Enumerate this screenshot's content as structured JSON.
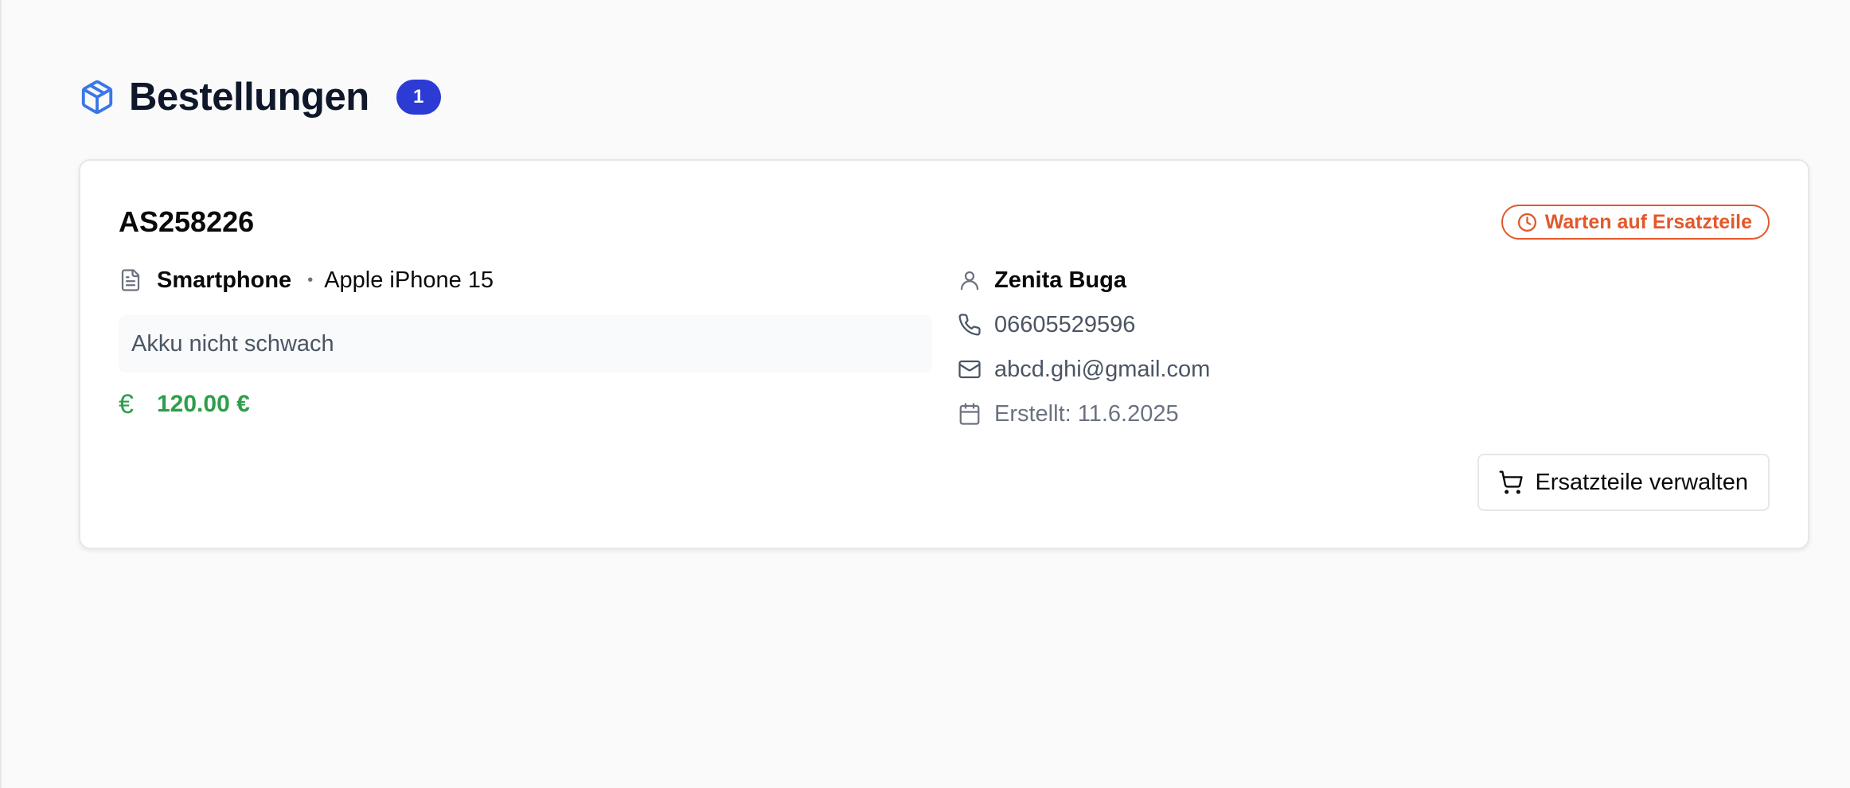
{
  "header": {
    "title": "Bestellungen",
    "count": "1",
    "icon": "package-icon",
    "icon_color": "#3b76e8",
    "badge_color": "#2b3bd3"
  },
  "order": {
    "id": "AS258226",
    "status": {
      "label": "Warten auf Ersatzteile",
      "icon": "clock-icon",
      "color": "#e2582b"
    },
    "device": {
      "type": "Smartphone",
      "separator": "•",
      "model": "Apple iPhone 15",
      "icon": "document-icon"
    },
    "issue": "Akku nicht schwach",
    "price": {
      "symbol": "€",
      "amount": "120.00 €",
      "color": "#2e9e4a"
    },
    "customer": {
      "name": "Zenita Buga",
      "phone": "06605529596",
      "email": "abcd.ghi@gmail.com",
      "created": "Erstellt: 11.6.2025"
    },
    "actions": {
      "manage_parts_label": "Ersatzteile verwalten",
      "manage_parts_icon": "cart-icon"
    }
  }
}
